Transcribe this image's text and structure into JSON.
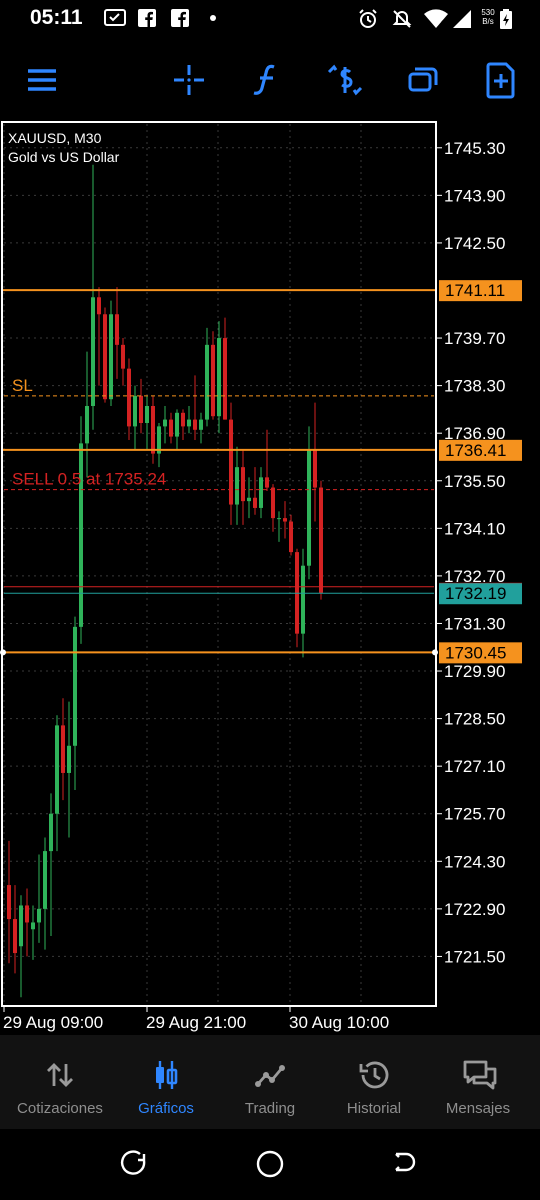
{
  "status_bar": {
    "time": "05:11",
    "net_speed_value": "530",
    "net_speed_unit": "B/s",
    "icons": [
      "checkbox-icon",
      "facebook-icon",
      "facebook-icon",
      "dot-icon",
      "alarm-icon",
      "mute-icon",
      "wifi-icon",
      "signal-icon",
      "battery-icon"
    ]
  },
  "toolbar": {
    "icons": [
      "menu-icon",
      "crosshair-icon",
      "indicators-icon",
      "trade-icon",
      "windows-icon",
      "new-order-icon"
    ],
    "accent": "#2f86ff"
  },
  "chart": {
    "symbol": "XAUUSD, M30",
    "description": "Gold vs US Dollar",
    "price_axis": [
      "1745.30",
      "1743.90",
      "1742.50",
      "1739.70",
      "1738.30",
      "1736.90",
      "1735.50",
      "1734.10",
      "1732.70",
      "1731.30",
      "1729.90",
      "1728.50",
      "1727.10",
      "1725.70",
      "1724.30",
      "1722.90",
      "1721.50"
    ],
    "time_axis": [
      "29 Aug 09:00",
      "29 Aug 21:00",
      "30 Aug 10:00"
    ],
    "sl_label": "SL",
    "order_label": "SELL 0.5 at 1735.24",
    "level_labels": [
      "1741.11",
      "1736.41",
      "1730.45"
    ],
    "current_price": "1732.19",
    "colors": {
      "bull": "#2fb35a",
      "bear": "#d42222",
      "level": "#f5921e",
      "current": "#21a09c",
      "frame": "#ffffff",
      "grid": "#3a3a3a"
    }
  },
  "chart_data": {
    "type": "candlestick",
    "symbol": "XAUUSD",
    "timeframe": "M30",
    "x": [
      "29 Aug 09:00",
      "29 Aug 21:00",
      "30 Aug 10:00"
    ],
    "ylim": [
      1720.1,
      1746.0
    ],
    "candles": [
      [
        1723.6,
        1724.9,
        1721.3,
        1722.6
      ],
      [
        1722.6,
        1723.6,
        1721.0,
        1721.6
      ],
      [
        1721.8,
        1723.3,
        1720.3,
        1723.0
      ],
      [
        1723.0,
        1723.5,
        1721.5,
        1722.5
      ],
      [
        1722.3,
        1723.0,
        1721.4,
        1722.5
      ],
      [
        1722.5,
        1724.5,
        1721.9,
        1722.9
      ],
      [
        1722.9,
        1725.0,
        1721.7,
        1724.6
      ],
      [
        1724.6,
        1726.3,
        1722.1,
        1725.7
      ],
      [
        1725.7,
        1728.6,
        1724.6,
        1728.3
      ],
      [
        1728.3,
        1729.1,
        1726.1,
        1726.9
      ],
      [
        1726.9,
        1729.0,
        1725.0,
        1727.7
      ],
      [
        1727.7,
        1731.5,
        1726.4,
        1731.2
      ],
      [
        1731.2,
        1737.4,
        1730.7,
        1736.6
      ],
      [
        1736.6,
        1739.3,
        1735.6,
        1737.7
      ],
      [
        1737.7,
        1744.8,
        1737.0,
        1740.9
      ],
      [
        1740.9,
        1741.2,
        1738.3,
        1740.4
      ],
      [
        1740.4,
        1740.6,
        1737.8,
        1737.9
      ],
      [
        1737.9,
        1740.8,
        1737.7,
        1740.4
      ],
      [
        1740.4,
        1741.2,
        1738.5,
        1739.5
      ],
      [
        1739.5,
        1739.7,
        1738.3,
        1738.8
      ],
      [
        1738.8,
        1739.1,
        1736.7,
        1737.1
      ],
      [
        1737.1,
        1738.3,
        1736.4,
        1738.0
      ],
      [
        1738.0,
        1738.5,
        1736.9,
        1737.2
      ],
      [
        1737.2,
        1738.0,
        1736.4,
        1737.7
      ],
      [
        1737.7,
        1738.0,
        1736.0,
        1736.3
      ],
      [
        1736.3,
        1737.2,
        1735.9,
        1737.1
      ],
      [
        1737.1,
        1737.7,
        1736.6,
        1737.3
      ],
      [
        1737.3,
        1737.5,
        1736.6,
        1736.8
      ],
      [
        1736.8,
        1737.6,
        1736.4,
        1737.5
      ],
      [
        1737.5,
        1737.6,
        1736.7,
        1737.1
      ],
      [
        1737.1,
        1737.7,
        1736.9,
        1737.3
      ],
      [
        1737.3,
        1738.6,
        1736.7,
        1737.0
      ],
      [
        1737.0,
        1737.5,
        1736.6,
        1737.3
      ],
      [
        1737.3,
        1740.0,
        1737.1,
        1739.5
      ],
      [
        1739.5,
        1739.9,
        1737.3,
        1737.4
      ],
      [
        1737.4,
        1740.2,
        1736.9,
        1739.7
      ],
      [
        1739.7,
        1740.3,
        1737.3,
        1737.3
      ],
      [
        1737.3,
        1737.8,
        1734.2,
        1734.8
      ],
      [
        1734.8,
        1736.5,
        1734.2,
        1735.9
      ],
      [
        1735.9,
        1736.4,
        1734.2,
        1734.9
      ],
      [
        1734.9,
        1735.6,
        1734.4,
        1735.0
      ],
      [
        1735.0,
        1735.9,
        1734.5,
        1734.7
      ],
      [
        1734.7,
        1735.9,
        1734.4,
        1735.6
      ],
      [
        1735.6,
        1737.0,
        1735.2,
        1735.3
      ],
      [
        1735.3,
        1735.4,
        1734.0,
        1734.4
      ],
      [
        1734.4,
        1734.6,
        1733.7,
        1734.4
      ],
      [
        1734.4,
        1734.9,
        1733.8,
        1734.3
      ],
      [
        1734.3,
        1734.5,
        1733.3,
        1733.4
      ],
      [
        1733.4,
        1733.5,
        1730.6,
        1731.0
      ],
      [
        1731.0,
        1733.5,
        1730.3,
        1733.0
      ],
      [
        1733.0,
        1737.1,
        1732.6,
        1736.4
      ],
      [
        1736.4,
        1737.8,
        1734.3,
        1735.3
      ],
      [
        1735.3,
        1735.5,
        1732.0,
        1732.2
      ]
    ],
    "levels": [
      1741.11,
      1736.41,
      1730.45
    ],
    "sl": 1738.0,
    "order_price": 1735.24,
    "current_bid": 1732.19,
    "current_ask": 1732.38
  },
  "bottom_nav": {
    "items": [
      {
        "label": "Cotizaciones",
        "icon": "quotes-icon",
        "active": false
      },
      {
        "label": "Gráficos",
        "icon": "charts-icon",
        "active": true
      },
      {
        "label": "Trading",
        "icon": "trading-icon",
        "active": false
      },
      {
        "label": "Historial",
        "icon": "history-icon",
        "active": false
      },
      {
        "label": "Mensajes",
        "icon": "messages-icon",
        "active": false
      }
    ]
  },
  "system_nav": {
    "icons": [
      "recents-icon",
      "home-icon",
      "back-icon"
    ]
  }
}
